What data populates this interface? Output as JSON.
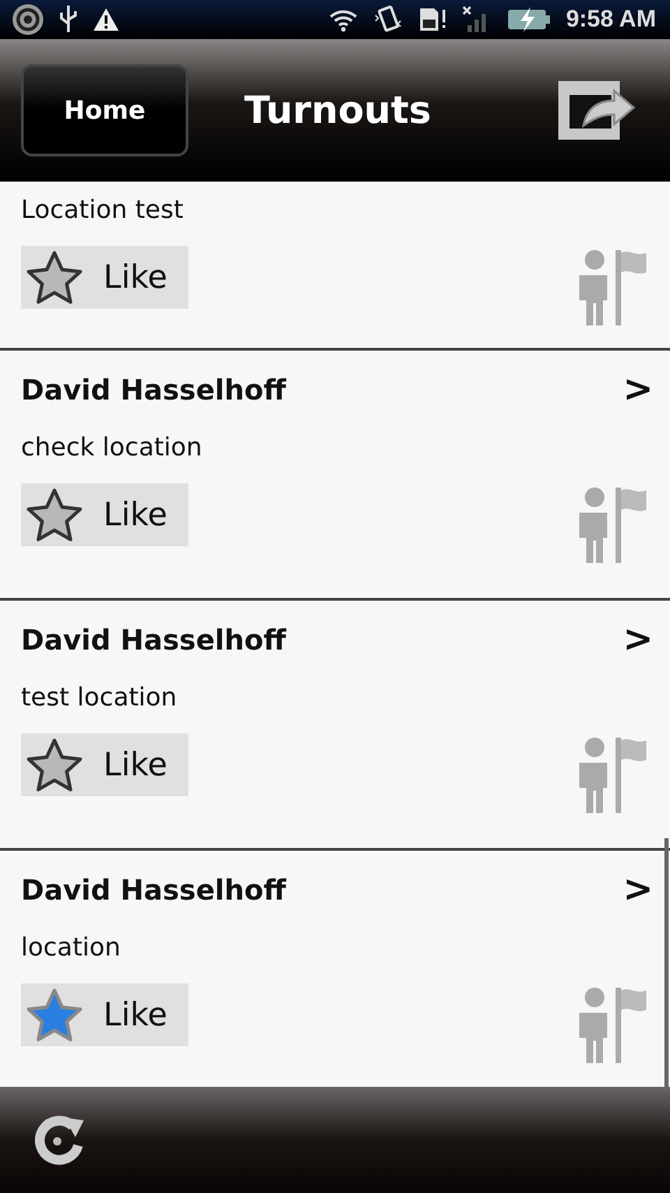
{
  "status_bar": {
    "time": "9:58 AM"
  },
  "header": {
    "home_button": "Home",
    "title": "Turnouts"
  },
  "posts": [
    {
      "message": "Location test",
      "like_label": "Like",
      "liked": false
    },
    {
      "author": "David Hasselhoff",
      "chevron": ">",
      "message": "check location",
      "like_label": "Like",
      "liked": false
    },
    {
      "author": "David Hasselhoff",
      "chevron": ">",
      "message": "test location",
      "like_label": "Like",
      "liked": false
    },
    {
      "author": "David Hasselhoff",
      "chevron": ">",
      "message": "location",
      "like_label": "Like",
      "liked": true
    }
  ]
}
